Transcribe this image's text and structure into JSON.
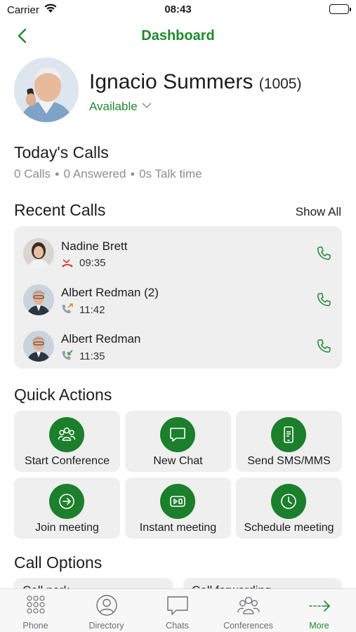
{
  "status_bar": {
    "carrier": "Carrier",
    "time": "08:43"
  },
  "header": {
    "title": "Dashboard",
    "back_icon": "chevron-left-icon"
  },
  "profile": {
    "name": "Ignacio Summers",
    "extension": "(1005)",
    "status": "Available"
  },
  "today": {
    "title": "Today's Calls",
    "calls": "0 Calls",
    "answered": "0 Answered",
    "talk_time": "0s Talk time"
  },
  "recent": {
    "title": "Recent Calls",
    "show_all": "Show All",
    "items": [
      {
        "name": "Nadine Brett",
        "time": "09:35",
        "type": "missed",
        "icon": "missed-call-icon"
      },
      {
        "name": "Albert Redman (2)",
        "time": "11:42",
        "type": "outgoing",
        "icon": "outgoing-call-icon"
      },
      {
        "name": "Albert Redman",
        "time": "11:35",
        "type": "incoming",
        "icon": "incoming-call-icon"
      }
    ]
  },
  "quick_actions": {
    "title": "Quick Actions",
    "items": [
      {
        "label": "Start Conference",
        "icon": "conference-icon"
      },
      {
        "label": "New Chat",
        "icon": "chat-icon"
      },
      {
        "label": "Send SMS/MMS",
        "icon": "sms-icon"
      },
      {
        "label": "Join meeting",
        "icon": "join-icon"
      },
      {
        "label": "Instant meeting",
        "icon": "video-icon"
      },
      {
        "label": "Schedule meeting",
        "icon": "clock-icon"
      }
    ]
  },
  "call_options": {
    "title": "Call Options",
    "items": [
      {
        "label": "Call park"
      },
      {
        "label": "Call forwarding"
      }
    ]
  },
  "tabs": [
    {
      "label": "Phone",
      "icon": "keypad-icon"
    },
    {
      "label": "Directory",
      "icon": "person-icon"
    },
    {
      "label": "Chats",
      "icon": "chat-bubble-icon"
    },
    {
      "label": "Conferences",
      "icon": "group-icon"
    },
    {
      "label": "More",
      "icon": "more-arrow-icon"
    }
  ],
  "colors": {
    "accent": "#1f8a2e",
    "button_green": "#1b7f2b",
    "card_bg": "#efefef",
    "muted": "#8e8e93"
  }
}
